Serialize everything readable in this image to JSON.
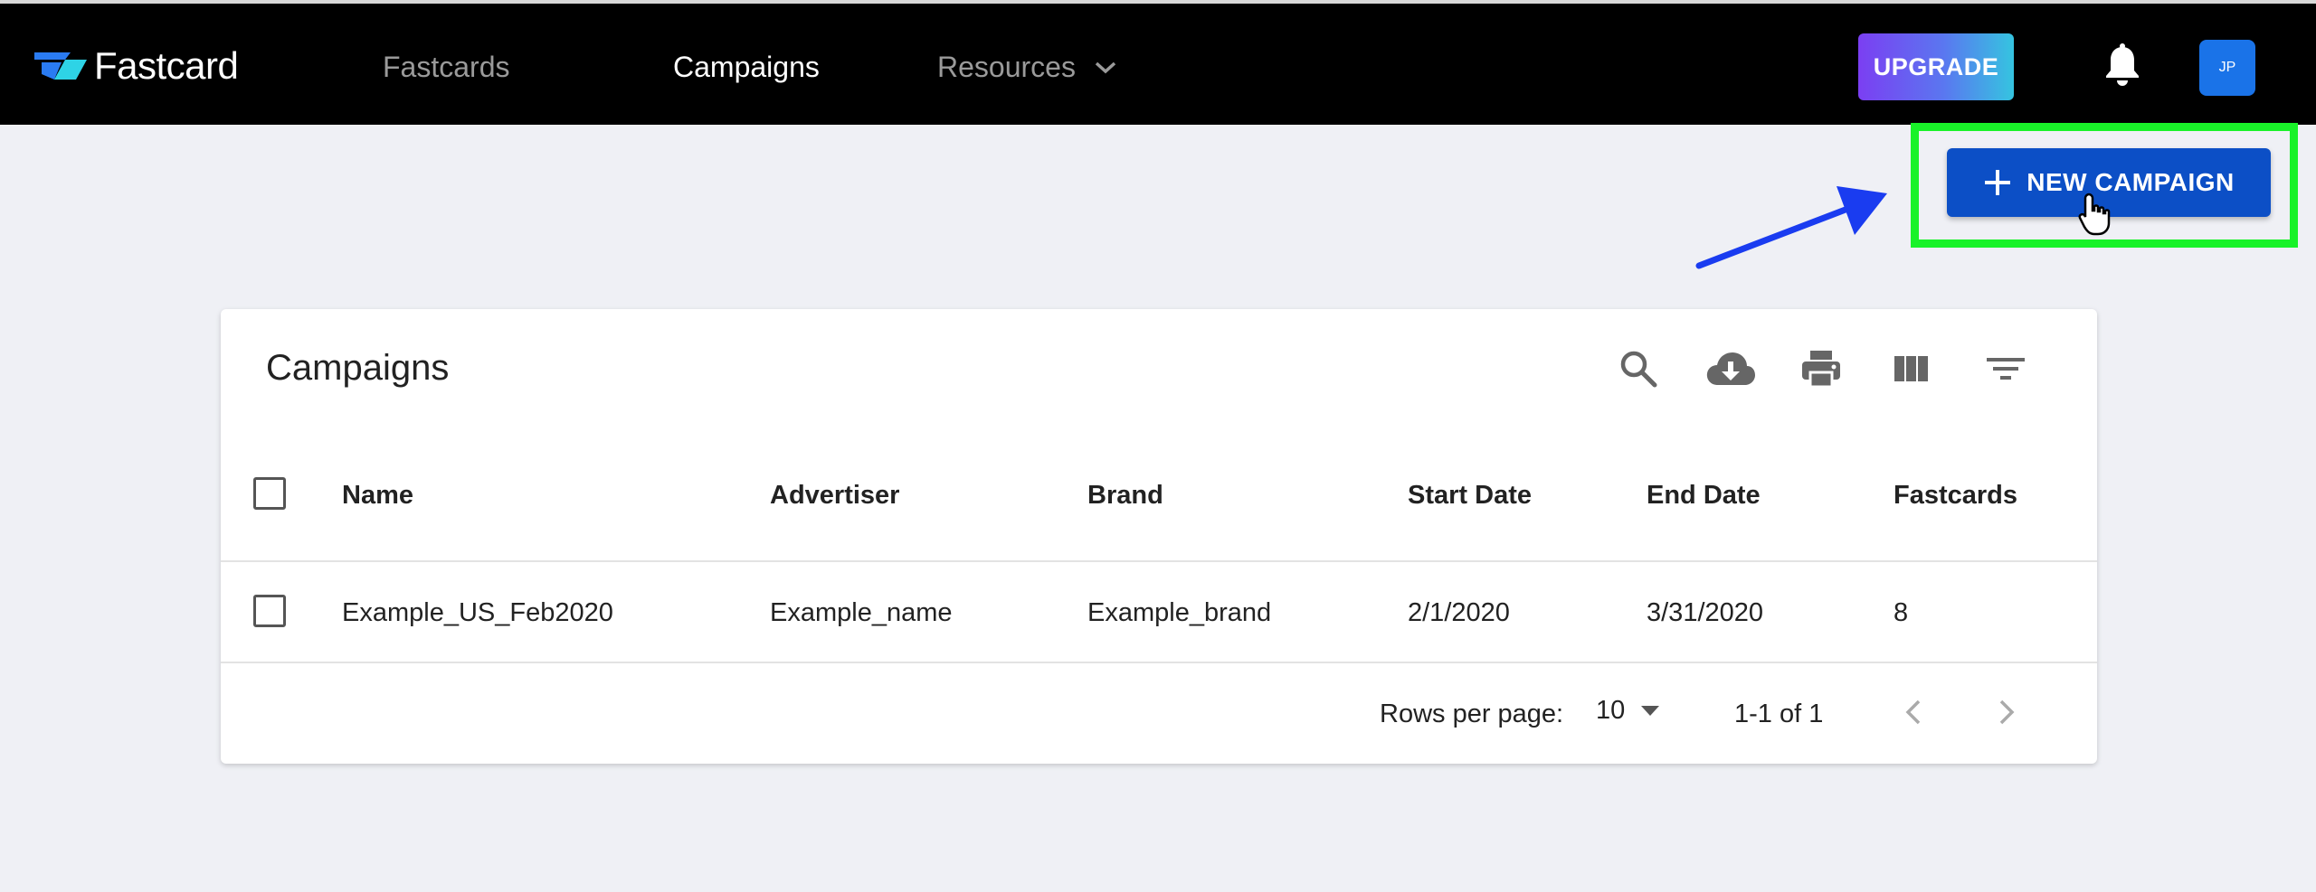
{
  "header": {
    "brand": "Fastcard",
    "nav": [
      {
        "label": "Fastcards"
      },
      {
        "label": "Campaigns"
      },
      {
        "label": "Resources"
      }
    ],
    "upgrade_label": "UPGRADE",
    "avatar_initials": "JP"
  },
  "actions": {
    "new_campaign_label": "NEW CAMPAIGN"
  },
  "table": {
    "title": "Campaigns",
    "columns": [
      "Name",
      "Advertiser",
      "Brand",
      "Start Date",
      "End Date",
      "Fastcards"
    ],
    "rows": [
      [
        "Example_US_Feb2020",
        "Example_name",
        "Example_brand",
        "2/1/2020",
        "3/31/2020",
        "8"
      ]
    ],
    "footer": {
      "rows_per_page_label": "Rows per page:",
      "rows_per_page_value": "10",
      "range": "1-1 of 1"
    }
  },
  "colors": {
    "primary": "#0c4fc6",
    "highlight": "#19f229",
    "annotation_arrow": "#1a3cf0"
  },
  "icons": [
    "search-icon",
    "cloud-download-icon",
    "print-icon",
    "view-column-icon",
    "filter-icon",
    "bell-icon",
    "chevron-down-icon",
    "plus-icon",
    "chevron-left-icon",
    "chevron-right-icon",
    "pointer-cursor-icon"
  ]
}
